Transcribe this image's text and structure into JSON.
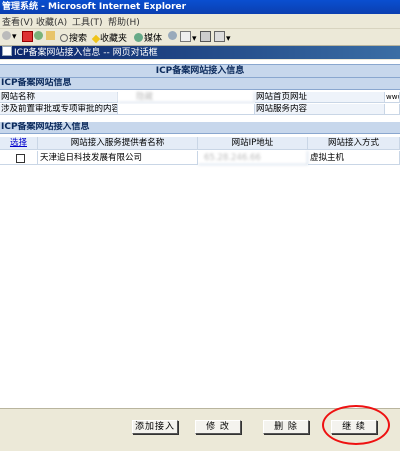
{
  "window": {
    "title": "管理系统 - Microsoft Internet Explorer"
  },
  "menu": [
    "查看(V)",
    "收藏(A)",
    "工具(T)",
    "帮助(H)"
  ],
  "toolbar": {
    "search": "搜索",
    "favorites": "收藏夹",
    "media": "媒体"
  },
  "dialog": {
    "title": "ICP备案网站接入信息 -- 网页对话框"
  },
  "page": {
    "heading": "ICP备案网站接入信息",
    "site_section": "ICP备案网站信息",
    "site": {
      "name_label": "网站名称",
      "name_value": "隐藏",
      "home_label": "网站首页网址",
      "home_value": "www",
      "prereview_label": "涉及前置审批或专项审批的内容",
      "service_label": "网站服务内容"
    },
    "access_section": "ICP备案网站接入信息",
    "table": {
      "headers": [
        "选择",
        "网站接入服务提供者名称",
        "网站IP地址",
        "网站接入方式"
      ],
      "rows": [
        {
          "provider": "天津追日科技发展有限公司",
          "ip": "65.28.246.66",
          "method": "虚拟主机"
        }
      ]
    }
  },
  "buttons": {
    "add": "添加接入",
    "edit": "修 改",
    "delete": "删 除",
    "continue": "继 续"
  },
  "colors": {
    "highlight_circle": "#ee1111",
    "section_bg": "#c7d7ec",
    "title_bar": "#0a246a"
  }
}
